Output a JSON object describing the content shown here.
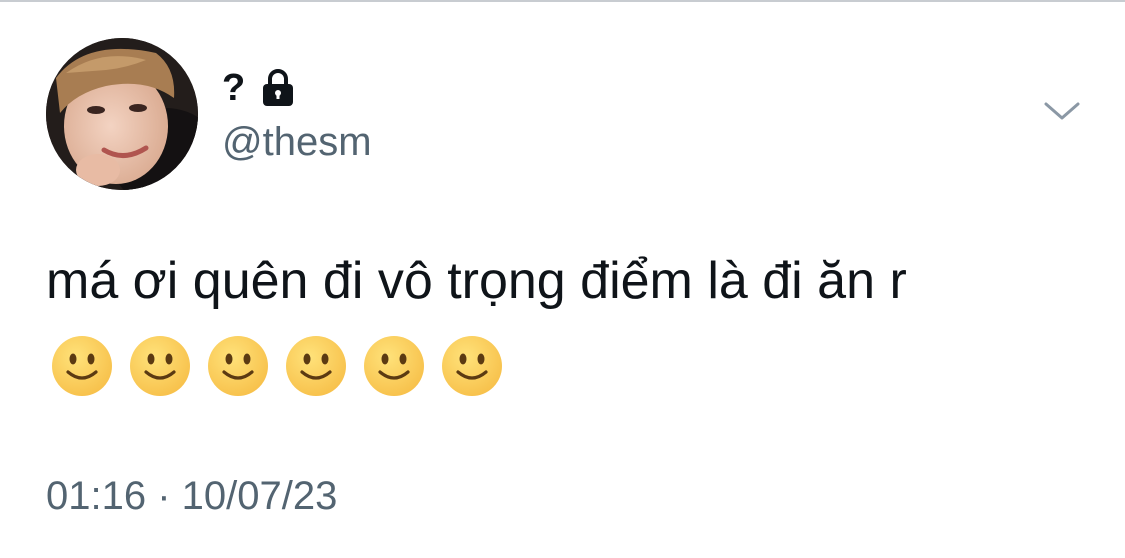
{
  "tweet": {
    "display_name": "?",
    "handle": "@thesm",
    "protected_icon": "lock-icon",
    "menu_icon": "chevron-down-icon",
    "text": "má ơi quên đi vô trọng điểm là đi ăn r",
    "emojis": [
      "slightly-smiling-face",
      "slightly-smiling-face",
      "slightly-smiling-face",
      "slightly-smiling-face",
      "slightly-smiling-face",
      "slightly-smiling-face"
    ],
    "timestamp": "01:16 · 10/07/23"
  },
  "colors": {
    "text_primary": "#0f1419",
    "text_secondary": "#536471",
    "emoji_face": "#f7c04a"
  }
}
